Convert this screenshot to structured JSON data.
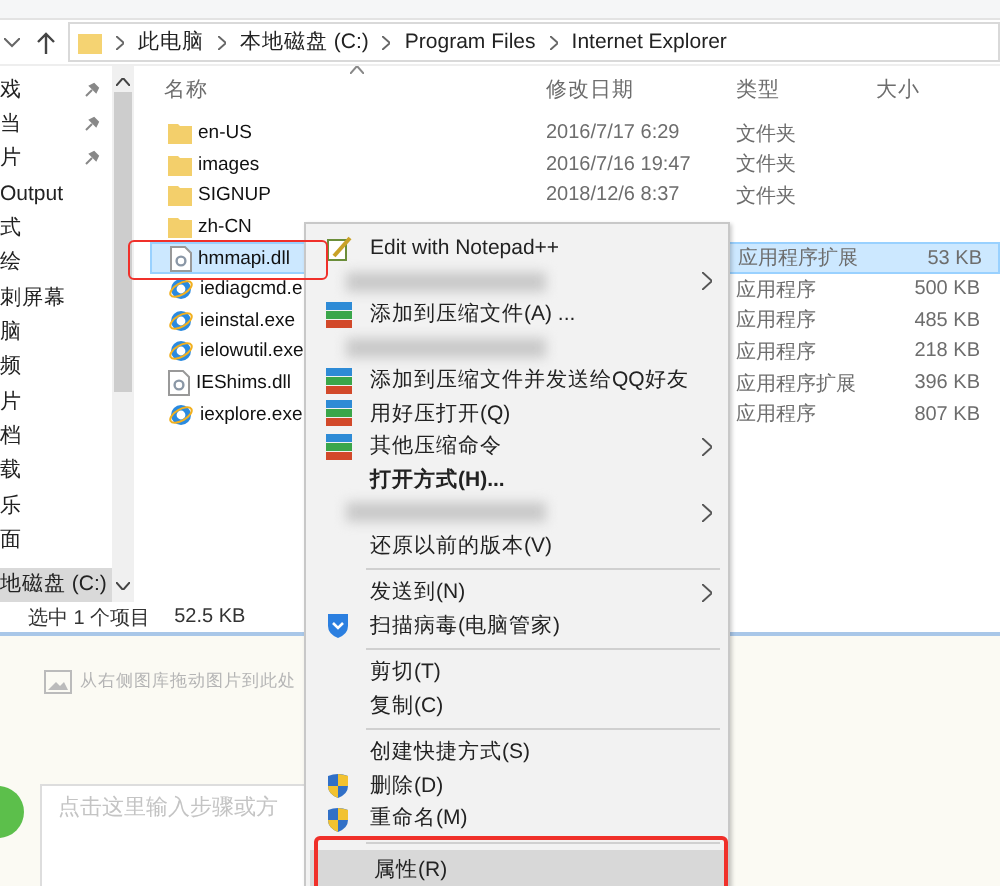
{
  "address_bar": {
    "crumbs": [
      "此电脑",
      "本地磁盘 (C:)",
      "Program Files",
      "Internet Explorer"
    ]
  },
  "nav_pane": {
    "items": [
      {
        "label": "戏",
        "pinned": true,
        "selected": false
      },
      {
        "label": "当",
        "pinned": true,
        "selected": false
      },
      {
        "label": "片",
        "pinned": true,
        "selected": false
      },
      {
        "label": "Output",
        "pinned": false,
        "selected": false
      },
      {
        "label": "式",
        "pinned": false,
        "selected": false
      },
      {
        "label": "绘",
        "pinned": false,
        "selected": false
      },
      {
        "label": "刺屏幕",
        "pinned": false,
        "selected": false
      },
      {
        "label": "脑",
        "pinned": false,
        "selected": false
      },
      {
        "label": "频",
        "pinned": false,
        "selected": false
      },
      {
        "label": "片",
        "pinned": false,
        "selected": false
      },
      {
        "label": "档",
        "pinned": false,
        "selected": false
      },
      {
        "label": "载",
        "pinned": false,
        "selected": false
      },
      {
        "label": "乐",
        "pinned": false,
        "selected": false
      },
      {
        "label": "面",
        "pinned": false,
        "selected": false
      },
      {
        "label": "地磁盘 (C:)",
        "pinned": false,
        "selected": true
      }
    ]
  },
  "file_list": {
    "columns": [
      "名称",
      "修改日期",
      "类型",
      "大小"
    ],
    "rows": [
      {
        "name": "en-US",
        "kind": "folder",
        "date": "2016/7/17 6:29",
        "type": "文件夹",
        "selected": false
      },
      {
        "name": "images",
        "kind": "folder",
        "date": "2016/7/16 19:47",
        "type": "文件夹",
        "selected": false
      },
      {
        "name": "SIGNUP",
        "kind": "folder",
        "date": "2018/12/6 8:37",
        "type": "文件夹",
        "selected": false
      },
      {
        "name": "zh-CN",
        "kind": "folder",
        "selected": false
      },
      {
        "name": "hmmapi.dll",
        "kind": "library",
        "type": "应用程序扩展",
        "size": "53 KB",
        "selected": true
      },
      {
        "name": "iediagcmd.e",
        "kind": "program",
        "type": "应用程序",
        "size": "500 KB",
        "selected": false
      },
      {
        "name": "ieinstal.exe",
        "kind": "program",
        "type": "应用程序",
        "size": "485 KB",
        "selected": false
      },
      {
        "name": "ielowutil.exe",
        "kind": "program",
        "type": "应用程序",
        "size": "218 KB",
        "selected": false
      },
      {
        "name": "IEShims.dll",
        "kind": "library",
        "type": "应用程序扩展",
        "size": "396 KB",
        "selected": false
      },
      {
        "name": "iexplore.exe",
        "kind": "program",
        "type": "应用程序",
        "size": "807 KB",
        "selected": false
      }
    ]
  },
  "status_bar": {
    "selection": "选中 1 个项目",
    "size": "52.5 KB"
  },
  "editor": {
    "image_hint": "从右侧图库拖动图片到此处",
    "step_placeholder": "点击这里输入步骤或方"
  },
  "context_menu": {
    "items": [
      {
        "kind": "notepad",
        "label": "Edit with Notepad++",
        "submenu": false,
        "bold": false,
        "selected": false
      },
      {
        "kind": "blurred",
        "submenu": true
      },
      {
        "kind": "archive",
        "label": "添加到压缩文件(A) ...",
        "submenu": false,
        "bold": false,
        "selected": false
      },
      {
        "kind": "blurred",
        "submenu": false
      },
      {
        "kind": "archive",
        "label": "添加到压缩文件并发送给QQ好友",
        "submenu": false,
        "bold": false,
        "selected": false
      },
      {
        "kind": "archive",
        "label": "用好压打开(Q)",
        "submenu": false,
        "bold": false,
        "selected": false
      },
      {
        "kind": "archive",
        "label": "其他压缩命令",
        "submenu": true,
        "bold": false,
        "selected": false
      },
      {
        "kind": "plain",
        "label": "打开方式(H)...",
        "submenu": false,
        "bold": true,
        "selected": false
      },
      {
        "kind": "blurred",
        "submenu": true
      },
      {
        "kind": "plain",
        "label": "还原以前的版本(V)",
        "submenu": false,
        "bold": false,
        "selected": false
      },
      {
        "kind": "separator"
      },
      {
        "kind": "plain",
        "label": "发送到(N)",
        "submenu": true,
        "bold": false,
        "selected": false
      },
      {
        "kind": "antivirus",
        "label": "扫描病毒(电脑管家)",
        "submenu": false,
        "bold": false,
        "selected": false
      },
      {
        "kind": "separator"
      },
      {
        "kind": "plain",
        "label": "剪切(T)",
        "submenu": false,
        "bold": false,
        "selected": false
      },
      {
        "kind": "plain",
        "label": "复制(C)",
        "submenu": false,
        "bold": false,
        "selected": false
      },
      {
        "kind": "separator"
      },
      {
        "kind": "plain",
        "label": "创建快捷方式(S)",
        "submenu": false,
        "bold": false,
        "selected": false
      },
      {
        "kind": "admin",
        "label": "删除(D)",
        "submenu": false,
        "bold": false,
        "selected": false
      },
      {
        "kind": "admin",
        "label": "重命名(M)",
        "submenu": false,
        "bold": false,
        "selected": false
      },
      {
        "kind": "separator"
      },
      {
        "kind": "plain",
        "label": "属性(R)",
        "submenu": false,
        "bold": false,
        "selected": true
      }
    ]
  }
}
